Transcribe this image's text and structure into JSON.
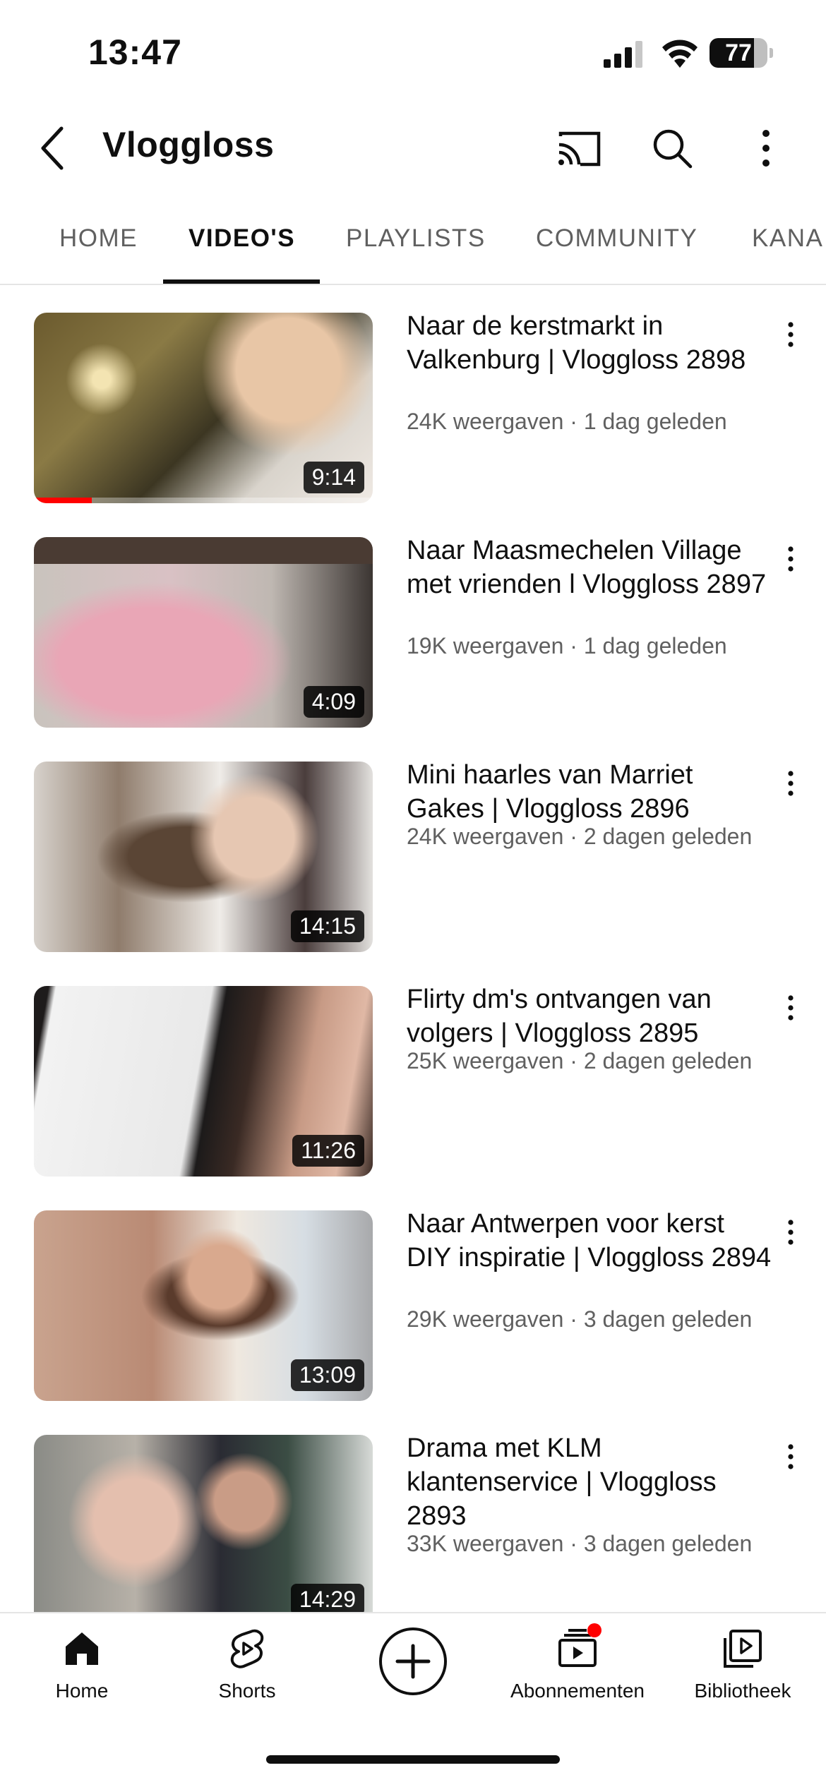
{
  "status_bar": {
    "time": "13:47",
    "battery_level": "77",
    "battery_fraction": 0.77
  },
  "app_bar": {
    "channel_name": "Vloggloss",
    "icons": [
      "back-arrow-icon",
      "cast-icon",
      "search-icon",
      "more-vertical-icon"
    ]
  },
  "tabs": [
    {
      "label": "HOME",
      "active": false
    },
    {
      "label": "VIDEO'S",
      "active": true
    },
    {
      "label": "PLAYLISTS",
      "active": false
    },
    {
      "label": "COMMUNITY",
      "active": false
    },
    {
      "label": "KANA",
      "active": false
    }
  ],
  "videos": [
    {
      "title": "Naar de kerstmarkt in Valkenburg | Vloggloss 2898",
      "meta": "24K weergaven · 1 dag geleden",
      "duration": "9:14",
      "watched_fraction": 0.17
    },
    {
      "title": "Naar Maasmechelen Village met vrienden l Vloggloss 2897",
      "meta": "19K weergaven · 1 dag geleden",
      "duration": "4:09"
    },
    {
      "title": "Mini haarles van Marriet Gakes | Vloggloss 2896",
      "meta": "24K weergaven · 2 dagen geleden",
      "duration": "14:15"
    },
    {
      "title": "Flirty dm's ontvangen van volgers | Vloggloss 2895",
      "meta": "25K weergaven · 2 dagen geleden",
      "duration": "11:26"
    },
    {
      "title": "Naar Antwerpen voor kerst DIY inspiratie | Vloggloss 2894",
      "meta": "29K weergaven · 3 dagen geleden",
      "duration": "13:09"
    },
    {
      "title": "Drama met KLM klantenservice | Vloggloss 2893",
      "meta": "33K weergaven · 3 dagen geleden",
      "duration": "14:29"
    }
  ],
  "bottom_nav": [
    {
      "label": "Home",
      "icon": "home-filled-icon"
    },
    {
      "label": "Shorts",
      "icon": "shorts-icon"
    },
    {
      "label": "",
      "icon": "create-plus-icon"
    },
    {
      "label": "Abonnementen",
      "icon": "subscriptions-icon"
    },
    {
      "label": "Bibliotheek",
      "icon": "library-icon"
    }
  ],
  "colors": {
    "accent": "#ff0000",
    "text_primary": "#0f0f0f",
    "text_secondary": "#606060"
  }
}
